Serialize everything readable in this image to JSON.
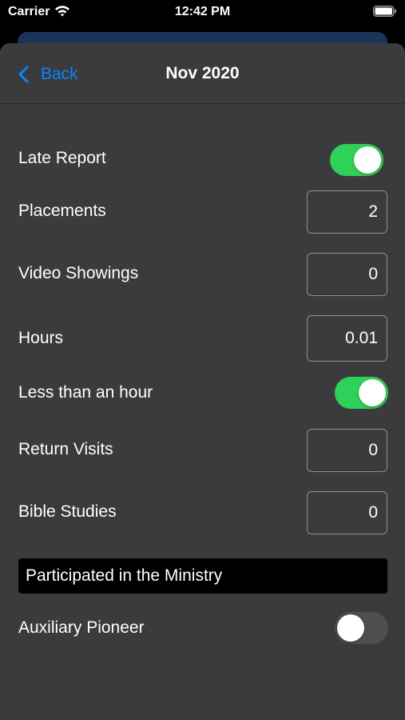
{
  "status_bar": {
    "carrier": "Carrier",
    "time": "12:42 PM"
  },
  "nav": {
    "back_label": "Back",
    "title": "Nov 2020"
  },
  "rows": {
    "late_report": {
      "label": "Late Report",
      "on": true
    },
    "placements": {
      "label": "Placements",
      "value": "2"
    },
    "video_showings": {
      "label": "Video Showings",
      "value": "0"
    },
    "hours": {
      "label": "Hours",
      "value": "0.01"
    },
    "less_than_hour": {
      "label": "Less than an hour",
      "on": true
    },
    "return_visits": {
      "label": "Return Visits",
      "value": "0"
    },
    "bible_studies": {
      "label": "Bible Studies",
      "value": "0"
    },
    "participated": {
      "label": "Participated in the Ministry"
    },
    "auxiliary_pioneer": {
      "label": "Auxiliary Pioneer",
      "on": false
    }
  },
  "colors": {
    "accent": "#0a84ff",
    "toggle_on": "#30d158",
    "toggle_off": "#4f4f52",
    "sheet_bg": "#3b3b3d"
  },
  "icons": [
    "wifi-icon",
    "battery-icon",
    "back-chevron-icon"
  ]
}
